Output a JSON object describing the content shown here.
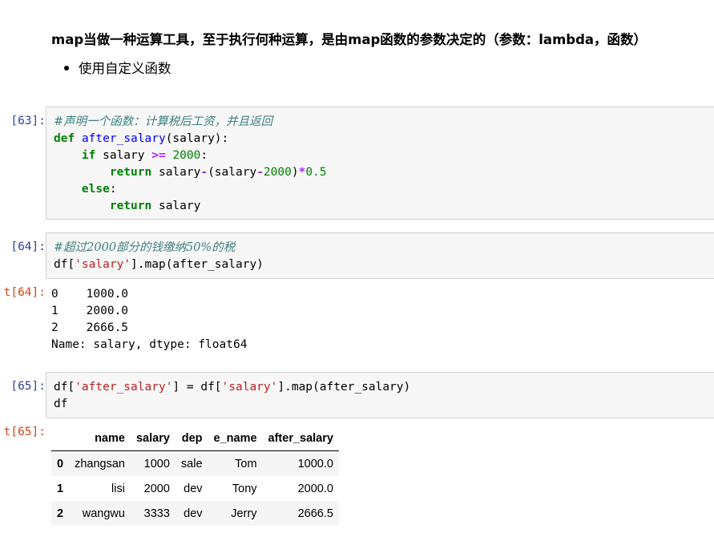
{
  "markdown": {
    "heading": "map当做一种运算工具，至于执行何种运算，是由map函数的参数决定的（参数：lambda，函数）",
    "bullet": "使用自定义函数"
  },
  "cells": [
    {
      "prompt": "[63]:",
      "code": {
        "comment": "#声明一个函数：计算税后工资，并且返回",
        "l2_kw": "def",
        "l2_fn": "after_salary",
        "l2_rest": "(salary):",
        "l3_kw": "if",
        "l3_a": " salary ",
        "l3_op": ">=",
        "l3_sp": " ",
        "l3_num": "2000",
        "l3_end": ":",
        "l4_kw": "return",
        "l4_a": " salary",
        "l4_op": "-",
        "l4_b": "(salary",
        "l4_op2": "-",
        "l4_num": "2000",
        "l4_c": ")",
        "l4_op3": "*",
        "l4_num2": "0.5",
        "l5_kw": "else",
        "l5_end": ":",
        "l6_kw": "return",
        "l6_a": " salary"
      }
    },
    {
      "prompt": "[64]:",
      "code": {
        "comment": "#超过2000部分的钱缴纳50%的税",
        "l2_a": "df[",
        "l2_str": "'salary'",
        "l2_b": "].map(after_salary)"
      },
      "out_prompt": "t[64]:",
      "output": [
        "0    1000.0",
        "1    2000.0",
        "2    2666.5",
        "Name: salary, dtype: float64"
      ]
    },
    {
      "prompt": "[65]:",
      "code": {
        "l1_a": "df[",
        "l1_str": "'after_salary'",
        "l1_b": "] = df[",
        "l1_str2": "'salary'",
        "l1_c": "].map(after_salary)",
        "l2": "df"
      },
      "out_prompt": "t[65]:",
      "table": {
        "columns": [
          "",
          "name",
          "salary",
          "dep",
          "e_name",
          "after_salary"
        ],
        "rows": [
          [
            "0",
            "zhangsan",
            "1000",
            "sale",
            "Tom",
            "1000.0"
          ],
          [
            "1",
            "lisi",
            "2000",
            "dev",
            "Tony",
            "2000.0"
          ],
          [
            "2",
            "wangwu",
            "3333",
            "dev",
            "Jerry",
            "2666.5"
          ]
        ]
      }
    }
  ]
}
